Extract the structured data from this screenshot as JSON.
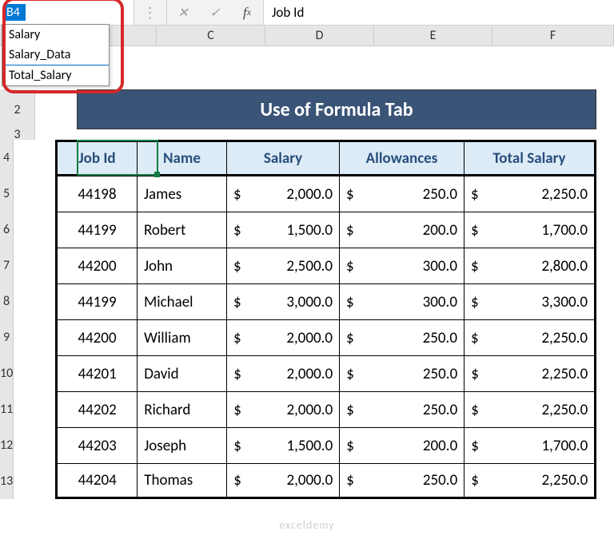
{
  "name_box": {
    "value": "B4"
  },
  "name_dropdown": {
    "items": [
      "Salary",
      "Salary_Data",
      "Total_Salary"
    ]
  },
  "formula_bar": {
    "value": "Job Id"
  },
  "col_headers": [
    "C",
    "D",
    "E",
    "F"
  ],
  "row_headers": [
    "2",
    "3",
    "4",
    "5",
    "6",
    "7",
    "8",
    "9",
    "10",
    "11",
    "12",
    "13"
  ],
  "title": "Use of Formula Tab",
  "table": {
    "headers": [
      "Job Id",
      "Name",
      "Salary",
      "Allowances",
      "Total Salary"
    ],
    "rows": [
      {
        "job_id": "44198",
        "name": "James",
        "salary": "2,000.0",
        "allow": "250.0",
        "total": "2,250.0"
      },
      {
        "job_id": "44199",
        "name": "Robert",
        "salary": "1,500.0",
        "allow": "200.0",
        "total": "1,700.0"
      },
      {
        "job_id": "44200",
        "name": "John",
        "salary": "2,500.0",
        "allow": "300.0",
        "total": "2,800.0"
      },
      {
        "job_id": "44199",
        "name": "Michael",
        "salary": "3,000.0",
        "allow": "300.0",
        "total": "3,300.0"
      },
      {
        "job_id": "44200",
        "name": "William",
        "salary": "2,000.0",
        "allow": "250.0",
        "total": "2,250.0"
      },
      {
        "job_id": "44201",
        "name": "David",
        "salary": "2,000.0",
        "allow": "250.0",
        "total": "2,250.0"
      },
      {
        "job_id": "44202",
        "name": "Richard",
        "salary": "2,000.0",
        "allow": "250.0",
        "total": "2,250.0"
      },
      {
        "job_id": "44203",
        "name": "Joseph",
        "salary": "1,500.0",
        "allow": "200.0",
        "total": "1,700.0"
      },
      {
        "job_id": "44204",
        "name": "Thomas",
        "salary": "2,000.0",
        "allow": "250.0",
        "total": "2,250.0"
      }
    ]
  },
  "currency": "$",
  "watermark": "exceldemy"
}
